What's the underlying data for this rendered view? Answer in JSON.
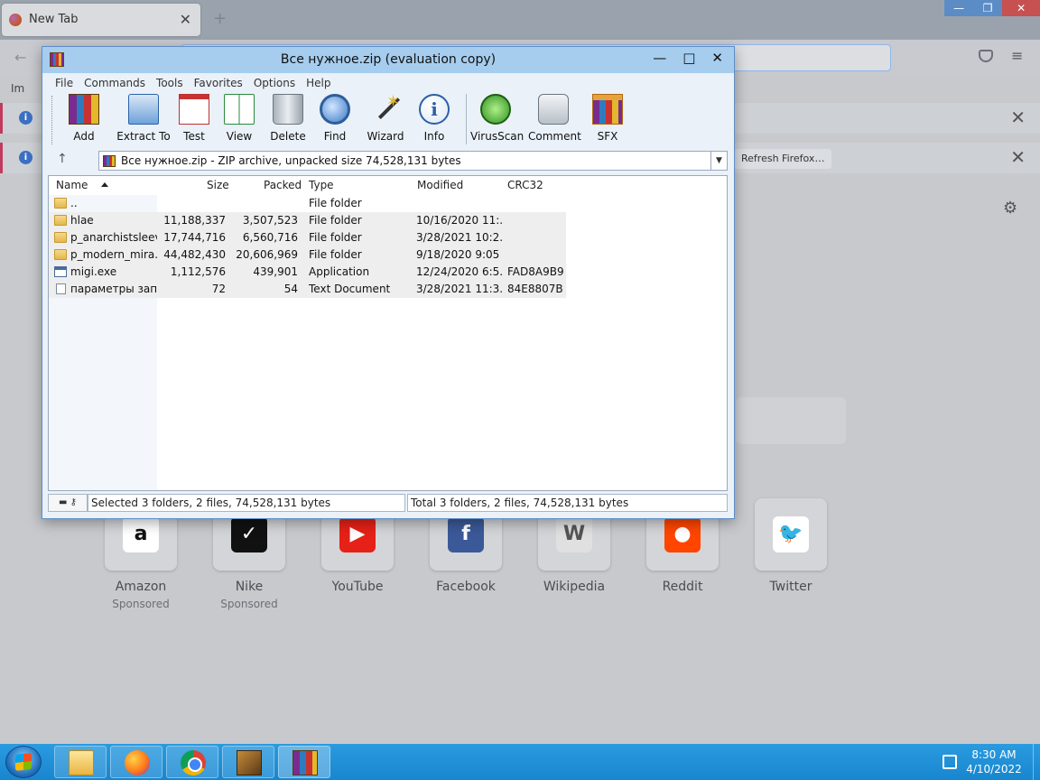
{
  "firefox": {
    "tab_title": "New Tab",
    "close_glyph": "✕",
    "new_tab_glyph": "+",
    "window_controls": [
      "—",
      "❐",
      "✕"
    ],
    "back_glyph": "←",
    "menu_glyph": "≡",
    "import_label": "Im",
    "bar_info_glyph": "i",
    "bar_close_glyph": "✕",
    "refresh_button": "Refresh Firefox…",
    "gear_glyph": "⚙",
    "shortcuts": [
      {
        "label": "Amazon",
        "sub": "Sponsored",
        "glyph": "a",
        "color": "#ffffff",
        "bg": "#ffffff"
      },
      {
        "label": "Nike",
        "sub": "Sponsored",
        "glyph": "✓",
        "color": "#ffffff",
        "bg": "#111111"
      },
      {
        "label": "YouTube",
        "sub": "",
        "glyph": "▶",
        "color": "#ffffff",
        "bg": "#e62117"
      },
      {
        "label": "Facebook",
        "sub": "",
        "glyph": "f",
        "color": "#ffffff",
        "bg": "#3b5998"
      },
      {
        "label": "Wikipedia",
        "sub": "",
        "glyph": "W",
        "color": "#555555",
        "bg": "#e0e0e0"
      },
      {
        "label": "Reddit",
        "sub": "",
        "glyph": "●",
        "color": "#ffffff",
        "bg": "#ff4500"
      },
      {
        "label": "Twitter",
        "sub": "",
        "glyph": "🐦",
        "color": "#1da1f2",
        "bg": "#ffffff"
      }
    ]
  },
  "winrar": {
    "title": "Все нужное.zip (evaluation copy)",
    "title_buttons": [
      "—",
      "□",
      "✕"
    ],
    "menu": [
      "File",
      "Commands",
      "Tools",
      "Favorites",
      "Options",
      "Help"
    ],
    "toolbar": [
      {
        "label": "Add",
        "icon": "add-icon"
      },
      {
        "label": "Extract To",
        "icon": "extract-icon"
      },
      {
        "label": "Test",
        "icon": "test-icon"
      },
      {
        "label": "View",
        "icon": "view-icon"
      },
      {
        "label": "Delete",
        "icon": "delete-icon"
      },
      {
        "label": "Find",
        "icon": "find-icon"
      },
      {
        "label": "Wizard",
        "icon": "wizard-icon"
      },
      {
        "label": "Info",
        "icon": "info-icon"
      },
      {
        "label": "VirusScan",
        "icon": "virusscan-icon"
      },
      {
        "label": "Comment",
        "icon": "comment-icon"
      },
      {
        "label": "SFX",
        "icon": "sfx-icon"
      }
    ],
    "info_glyph": "i",
    "up_glyph": "↑",
    "dropdown_glyph": "▼",
    "path_text": "Все нужное.zip - ZIP archive, unpacked size 74,528,131 bytes",
    "columns": [
      "Name",
      "Size",
      "Packed",
      "Type",
      "Modified",
      "CRC32"
    ],
    "files": [
      {
        "name": "..",
        "size": "",
        "packed": "",
        "type": "File folder",
        "modified": "",
        "crc": "",
        "kind": "folder",
        "selected": false
      },
      {
        "name": "hlae",
        "size": "11,188,337",
        "packed": "3,507,523",
        "type": "File folder",
        "modified": "10/16/2020 11:...",
        "crc": "",
        "kind": "folder",
        "selected": true
      },
      {
        "name": "p_anarchistsleev...",
        "size": "17,744,716",
        "packed": "6,560,716",
        "type": "File folder",
        "modified": "3/28/2021 10:2...",
        "crc": "",
        "kind": "folder",
        "selected": true
      },
      {
        "name": "p_modern_mira...",
        "size": "44,482,430",
        "packed": "20,606,969",
        "type": "File folder",
        "modified": "9/18/2020 9:05 ...",
        "crc": "",
        "kind": "folder",
        "selected": true
      },
      {
        "name": "migi.exe",
        "size": "1,112,576",
        "packed": "439,901",
        "type": "Application",
        "modified": "12/24/2020 6:5...",
        "crc": "FAD8A9B9",
        "kind": "exe",
        "selected": true
      },
      {
        "name": "параметры зап...",
        "size": "72",
        "packed": "54",
        "type": "Text Document",
        "modified": "3/28/2021 11:3...",
        "crc": "84E8807B",
        "kind": "txt",
        "selected": true
      }
    ],
    "status_icons": "▬ ⚷",
    "status_left": "Selected 3 folders, 2 files, 74,528,131 bytes",
    "status_right": "Total 3 folders, 2 files, 74,528,131 bytes"
  },
  "taskbar": {
    "items": [
      "explorer",
      "firefox",
      "chrome",
      "counter-strike",
      "winrar"
    ],
    "time": "8:30 AM",
    "date": "4/10/2022"
  }
}
